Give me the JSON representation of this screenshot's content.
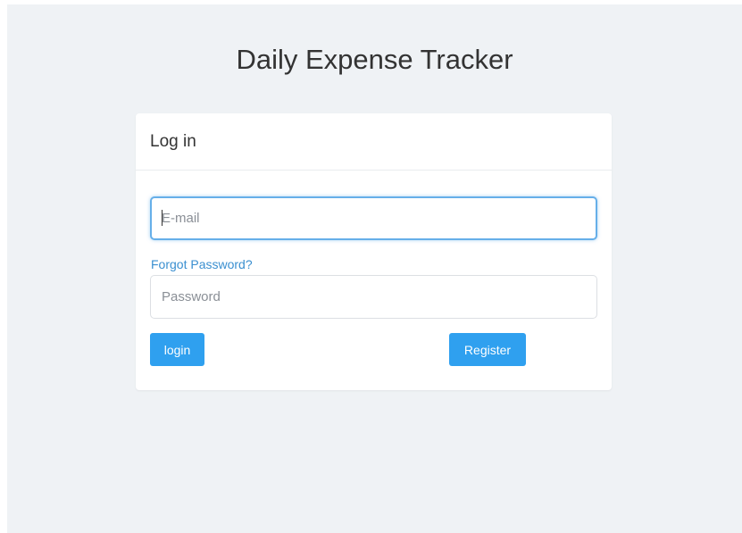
{
  "app": {
    "title": "Daily Expense Tracker"
  },
  "login_card": {
    "title": "Log in",
    "email_placeholder": "E-mail",
    "email_value": "",
    "forgot_password_label": "Forgot Password?",
    "password_placeholder": "Password",
    "password_value": "",
    "login_label": "login",
    "register_label": "Register"
  },
  "colors": {
    "page_background": "#eff2f5",
    "card_background": "#ffffff",
    "primary_button": "#2fa0ef",
    "link": "#3a8fd0",
    "focus_border": "#66afe9"
  }
}
